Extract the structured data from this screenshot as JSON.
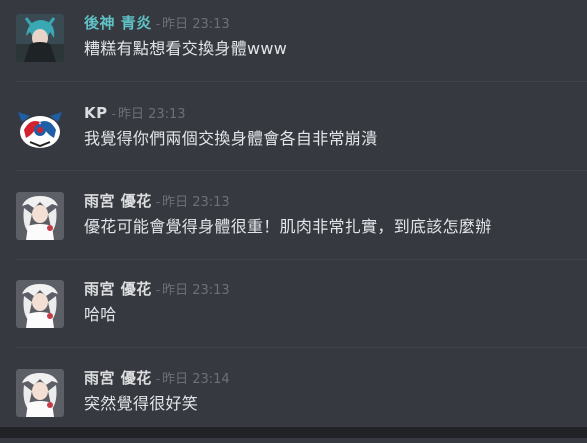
{
  "messages": [
    {
      "username": "後神 青炎",
      "name_color": "#5fc1c6",
      "timestamp": "昨日 23:13",
      "content": "糟糕有點想看交換身體www",
      "avatar": "avatar-icon-blue-haired-character"
    },
    {
      "username": "KP",
      "name_color": "#dcddde",
      "timestamp": "昨日 23:13",
      "content": "我覺得你們兩個交換身體會各自非常崩潰",
      "avatar": "avatar-icon-red-blue-mascot"
    },
    {
      "username": "雨宮 優花",
      "name_color": "#dcddde",
      "timestamp": "昨日 23:13",
      "content": "優花可能會覺得身體很重！肌肉非常扎實，到底該怎麼辦",
      "avatar": "avatar-icon-white-haired-girl"
    },
    {
      "username": "雨宮 優花",
      "name_color": "#dcddde",
      "timestamp": "昨日 23:13",
      "content": "哈哈",
      "avatar": "avatar-icon-white-haired-girl"
    },
    {
      "username": "雨宮 優花",
      "name_color": "#dcddde",
      "timestamp": "昨日 23:14",
      "content": "突然覺得很好笑",
      "avatar": "avatar-icon-white-haired-girl"
    }
  ],
  "separator": "-",
  "colors": {
    "background": "#36393f",
    "divider": "#41444a",
    "timestamp": "#6d7076",
    "message_text": "#e3e5e8"
  }
}
